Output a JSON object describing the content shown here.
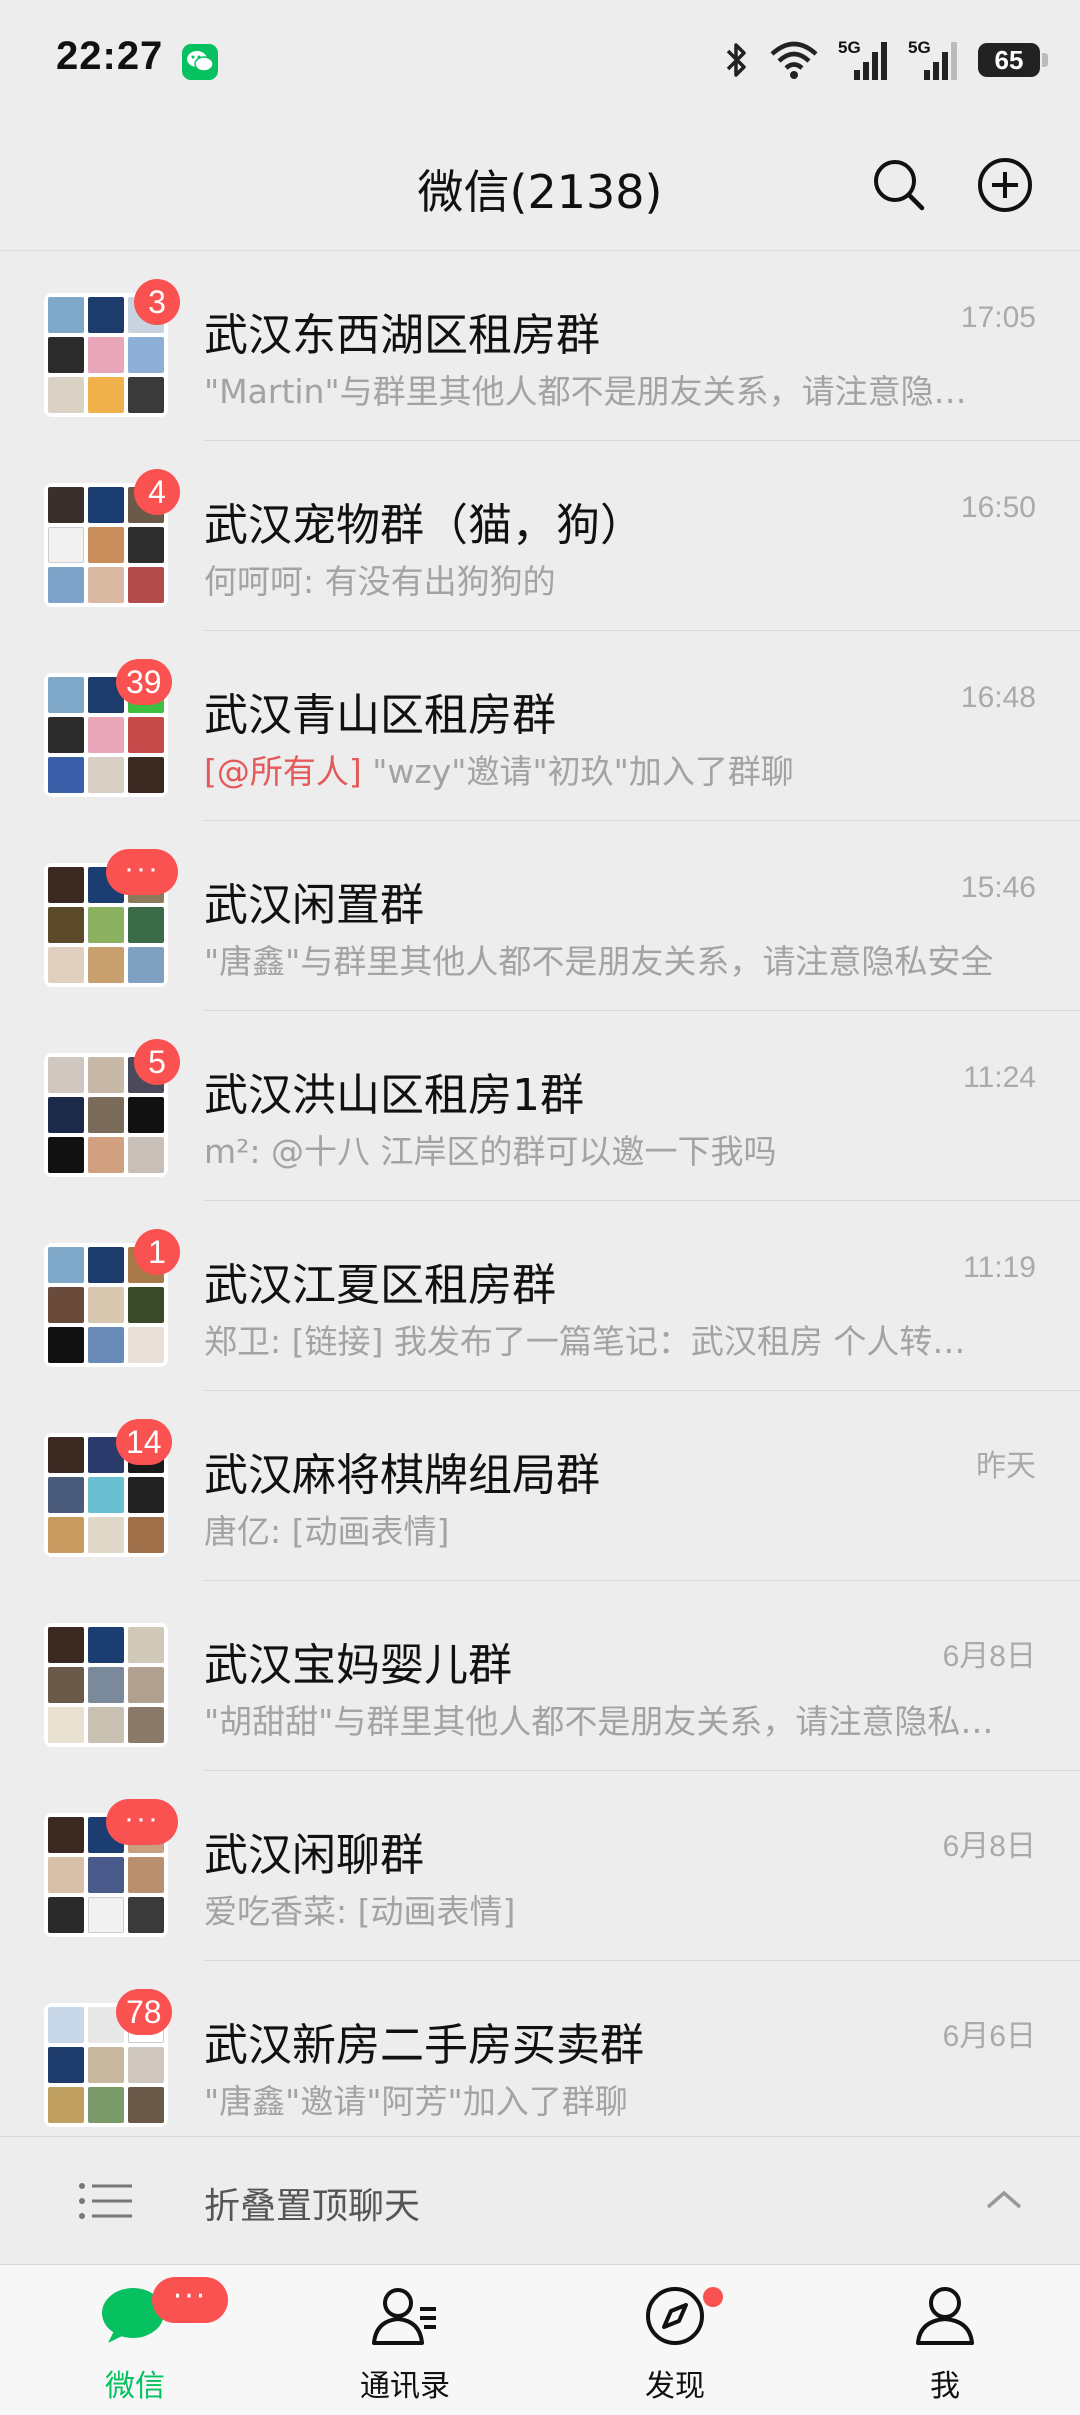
{
  "status_bar": {
    "time": "22:27",
    "battery": "65",
    "signal_1_label": "5G",
    "signal_2_label": "5G",
    "icons": [
      "wechat-icon",
      "bluetooth-icon",
      "wifi-icon",
      "signal-icon",
      "signal-icon",
      "battery-icon"
    ]
  },
  "header": {
    "title": "微信(2138)",
    "actions": [
      "search-icon",
      "add-circle-icon"
    ]
  },
  "chats": [
    {
      "title": "武汉东西湖区租房群",
      "time": "17:05",
      "preview": "\"Martin\"与群里其他人都不是朋友关系，请注意隐私安全",
      "badge": "3"
    },
    {
      "title": "武汉宠物群（猫，狗）",
      "time": "16:50",
      "preview": "何呵呵: 有没有出狗狗的",
      "badge": "4"
    },
    {
      "title": "武汉青山区租房群",
      "time": "16:48",
      "mention": "[@所有人]",
      "preview": " \"wzy\"邀请\"初玖\"加入了群聊",
      "badge": "39"
    },
    {
      "title": "武汉闲置群",
      "time": "15:46",
      "preview": "\"唐鑫\"与群里其他人都不是朋友关系，请注意隐私安全",
      "badge": "···"
    },
    {
      "title": "武汉洪山区租房1群",
      "time": "11:24",
      "preview": "m²: @十八 江岸区的群可以邀一下我吗",
      "badge": "5"
    },
    {
      "title": "武汉江夏区租房群",
      "time": "11:19",
      "preview": "郑卫: [链接] 我发布了一篇笔记：武汉租房 个人转租房源",
      "badge": "1"
    },
    {
      "title": "武汉麻将棋牌组局群",
      "time": "昨天",
      "preview": "唐亿: [动画表情]",
      "badge": "14"
    },
    {
      "title": "武汉宝妈婴儿群",
      "time": "6月8日",
      "preview": "\"胡甜甜\"与群里其他人都不是朋友关系，请注意隐私安全",
      "badge": ""
    },
    {
      "title": "武汉闲聊群",
      "time": "6月8日",
      "preview": "爱吃香菜: [动画表情]",
      "badge": "···"
    },
    {
      "title": "武汉新房二手房买卖群",
      "time": "6月6日",
      "preview": "\"唐鑫\"邀请\"阿芳\"加入了群聊",
      "badge": "78"
    }
  ],
  "collapse": {
    "label": "折叠置顶聊天"
  },
  "tabs": [
    {
      "label": "微信",
      "icon": "chat-bubble-icon",
      "badge": "···"
    },
    {
      "label": "通讯录",
      "icon": "contacts-icon"
    },
    {
      "label": "发现",
      "icon": "compass-icon"
    },
    {
      "label": "我",
      "icon": "person-icon"
    }
  ],
  "colors": {
    "accent": "#07c160",
    "badge": "#fa5151",
    "background": "#ededed"
  }
}
